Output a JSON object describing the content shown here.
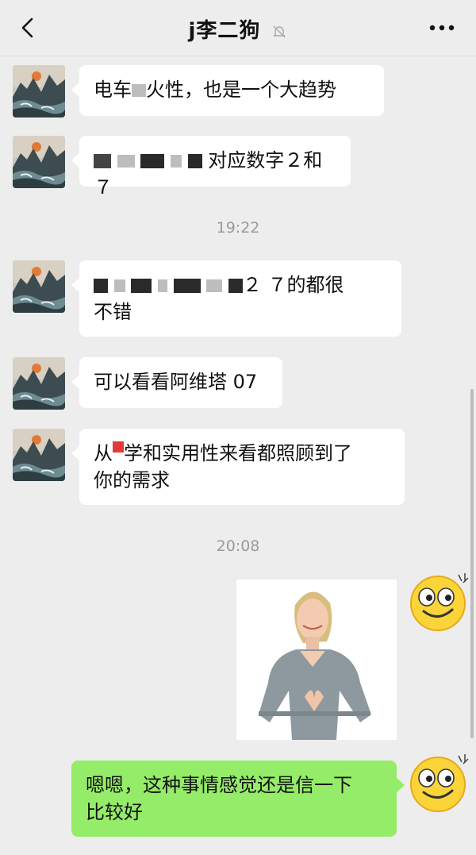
{
  "header": {
    "title": "j李二狗",
    "back_icon": "chevron-left-icon",
    "mute_icon": "bell-off-icon",
    "more_icon": "ellipsis-icon"
  },
  "messages": [
    {
      "sender": "contact",
      "parts": [
        "电车",
        "火性，也是一个大趋势"
      ]
    },
    {
      "sender": "contact",
      "parts": [
        "对应数字２和７"
      ]
    },
    {
      "sender": "contact",
      "parts": [
        "２ ７的都很",
        "不错"
      ]
    },
    {
      "sender": "contact",
      "parts": [
        "可以看看阿维塔 07"
      ]
    },
    {
      "sender": "contact",
      "parts": [
        "从",
        "学和实用性来看都照顾到了",
        "你的需求"
      ]
    },
    {
      "sender": "me",
      "type": "image"
    },
    {
      "sender": "me",
      "parts": [
        "嗯嗯，这种事情感觉还是信一下",
        "比较好"
      ]
    }
  ],
  "timestamps": [
    "19:22",
    "20:08"
  ],
  "colors": {
    "background": "#ededed",
    "bubble_contact": "#ffffff",
    "bubble_me": "#95ec69"
  }
}
